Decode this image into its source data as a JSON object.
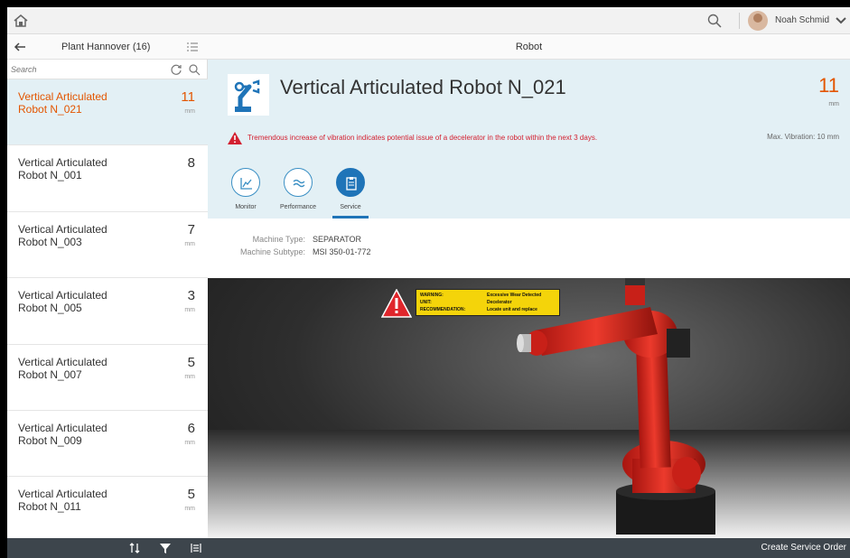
{
  "shell": {
    "user_name": "Noah Schmid"
  },
  "master": {
    "title": "Plant Hannover (16)",
    "search_placeholder": "Search",
    "items": [
      {
        "name": "Vertical Articulated Robot N_021",
        "value": "11",
        "unit": "mm",
        "selected": true
      },
      {
        "name": "Vertical Articulated Robot N_001",
        "value": "8",
        "unit": "",
        "selected": false
      },
      {
        "name": "Vertical Articulated Robot N_003",
        "value": "7",
        "unit": "mm",
        "selected": false
      },
      {
        "name": "Vertical Articulated Robot N_005",
        "value": "3",
        "unit": "mm",
        "selected": false
      },
      {
        "name": "Vertical Articulated Robot N_007",
        "value": "5",
        "unit": "mm",
        "selected": false
      },
      {
        "name": "Vertical Articulated Robot N_009",
        "value": "6",
        "unit": "mm",
        "selected": false
      },
      {
        "name": "Vertical Articulated Robot N_011",
        "value": "5",
        "unit": "mm",
        "selected": false
      }
    ]
  },
  "detail": {
    "header": "Robot",
    "object": {
      "title": "Vertical Articulated Robot N_021",
      "number": "11",
      "unit": "mm",
      "warning": "Tremendous increase of vibration indicates potential issue of a decelerator in the robot within the next 3 days.",
      "max_vibration": "Max. Vibration: 10 mm"
    },
    "tabs": [
      {
        "label": "Monitor",
        "icon": "chart-icon",
        "active": false
      },
      {
        "label": "Performance",
        "icon": "wave-icon",
        "active": false
      },
      {
        "label": "Service",
        "icon": "clipboard-icon",
        "active": true
      }
    ],
    "attributes": {
      "machine_type_label": "Machine Type:",
      "machine_type": "SEPARATOR",
      "machine_subtype_label": "Machine Subtype:",
      "machine_subtype": "MSI 350-01-772"
    },
    "warning_label": {
      "rows": [
        {
          "k": "WARNING:",
          "v": "Excessive Wear Detected"
        },
        {
          "k": "UNIT:",
          "v": "Decelerator"
        },
        {
          "k": "RECOMMENDATION:",
          "v": "Locate unit and replace"
        }
      ]
    }
  },
  "footer": {
    "create_button": "Create Service Order"
  },
  "colors": {
    "accent": "#1f74b8",
    "alert": "#e35500",
    "error": "#d32030",
    "selected_bg": "#e3f0f5",
    "footer_bg": "#3d454c",
    "robot": "#d8261c"
  }
}
